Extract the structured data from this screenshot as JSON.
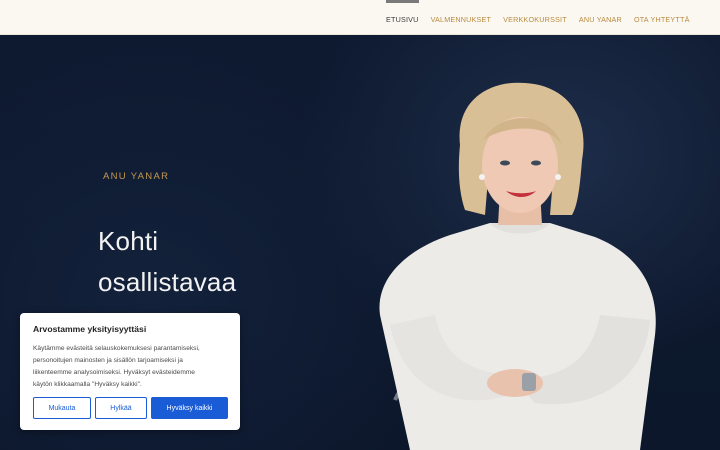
{
  "nav": {
    "items": [
      {
        "label": "ETUSIVU",
        "active": true
      },
      {
        "label": "VALMENNUKSET",
        "active": false
      },
      {
        "label": "VERKKOKURSSIT",
        "active": false
      },
      {
        "label": "ANU YANAR",
        "active": false
      },
      {
        "label": "OTA YHTEYTTÄ",
        "active": false
      }
    ]
  },
  "hero": {
    "kicker": "ANU YANAR",
    "headline_line1": "Kohti",
    "headline_line2": "osallistavaa",
    "background_color": "#0f1c33",
    "accent_color": "#c4994d"
  },
  "cookie_banner": {
    "title": "Arvostamme yksityisyyttäsi",
    "text_lines": [
      "Käytämme evästeitä selauskokemuksesi parantamiseksi,",
      "personoitujen mainosten ja sisällön tarjoamiseksi ja",
      "liikenteemme analysoimiseksi. Hyväksyt evästeidemme",
      "käytön klikkaamalla \"Hyväksy kaikki\"."
    ],
    "customize_label": "Mukauta",
    "reject_label": "Hylkää",
    "accept_all_label": "Hyväksy kaikki",
    "button_color": "#1a5bd6"
  }
}
